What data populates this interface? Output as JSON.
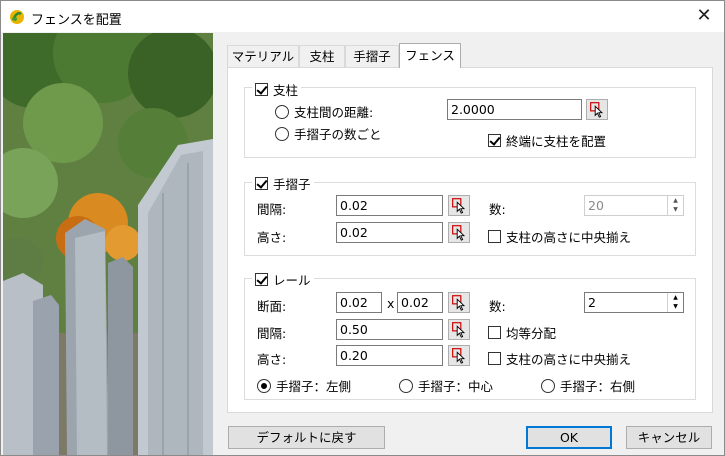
{
  "window": {
    "title": "フェンスを配置",
    "close_glyph": "✕"
  },
  "tabs": [
    {
      "label": "マテリアル"
    },
    {
      "label": "支柱"
    },
    {
      "label": "手摺子"
    },
    {
      "label": "フェンス"
    }
  ],
  "post": {
    "legend": "支柱",
    "checked": true,
    "spacing_label": "支柱間の距離:",
    "spacing_value": "2.0000",
    "per_baluster_label": "手摺子の数ごと",
    "place_end_label": "終端に支柱を配置",
    "place_end_checked": true
  },
  "baluster": {
    "legend": "手摺子",
    "checked": true,
    "spacing_label": "間隔:",
    "spacing_value": "0.02",
    "height_label": "高さ:",
    "height_value": "0.02",
    "count_label": "数:",
    "count_value": "20",
    "center_label": "支柱の高さに中央揃え"
  },
  "rail": {
    "legend": "レール",
    "checked": true,
    "section_label": "断面:",
    "section_w": "0.02",
    "section_x": "x",
    "section_h": "0.02",
    "count_label": "数:",
    "count_value": "2",
    "spacing_label": "間隔:",
    "spacing_value": "0.50",
    "equal_label": "均等分配",
    "height_label": "高さ:",
    "height_value": "0.20",
    "center_label": "支柱の高さに中央揃え",
    "position_options": [
      "手摺子：左側",
      "手摺子：中心",
      "手摺子：右側"
    ]
  },
  "buttons": {
    "reset": "デフォルトに戻す",
    "ok": "OK",
    "cancel": "キャンセル"
  }
}
